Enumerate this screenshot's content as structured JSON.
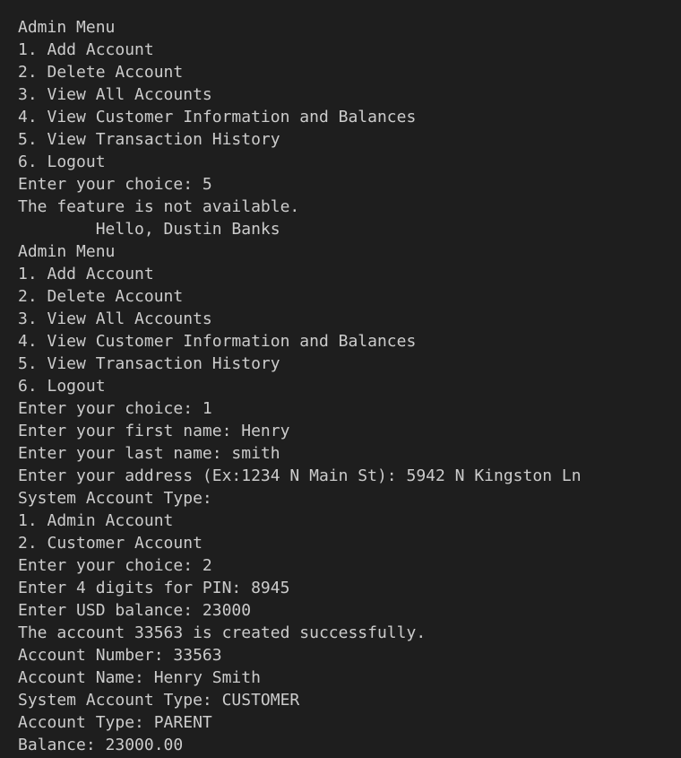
{
  "terminal": {
    "lines": [
      "Admin Menu",
      "1. Add Account",
      "2. Delete Account",
      "3. View All Accounts",
      "4. View Customer Information and Balances",
      "5. View Transaction History",
      "6. Logout",
      "Enter your choice: 5",
      "The feature is not available.",
      "\tHello, Dustin Banks",
      "Admin Menu",
      "1. Add Account",
      "2. Delete Account",
      "3. View All Accounts",
      "4. View Customer Information and Balances",
      "5. View Transaction History",
      "6. Logout",
      "Enter your choice: 1",
      "Enter your first name: Henry",
      "Enter your last name: smith",
      "Enter your address (Ex:1234 N Main St): 5942 N Kingston Ln",
      "System Account Type:",
      "1. Admin Account",
      "2. Customer Account",
      "Enter your choice: 2",
      "Enter 4 digits for PIN: 8945",
      "Enter USD balance: 23000",
      "The account 33563 is created successfully.",
      "Account Number: 33563",
      "Account Name: Henry Smith",
      "System Account Type: CUSTOMER",
      "Account Type: PARENT",
      "Balance: 23000.00"
    ]
  }
}
